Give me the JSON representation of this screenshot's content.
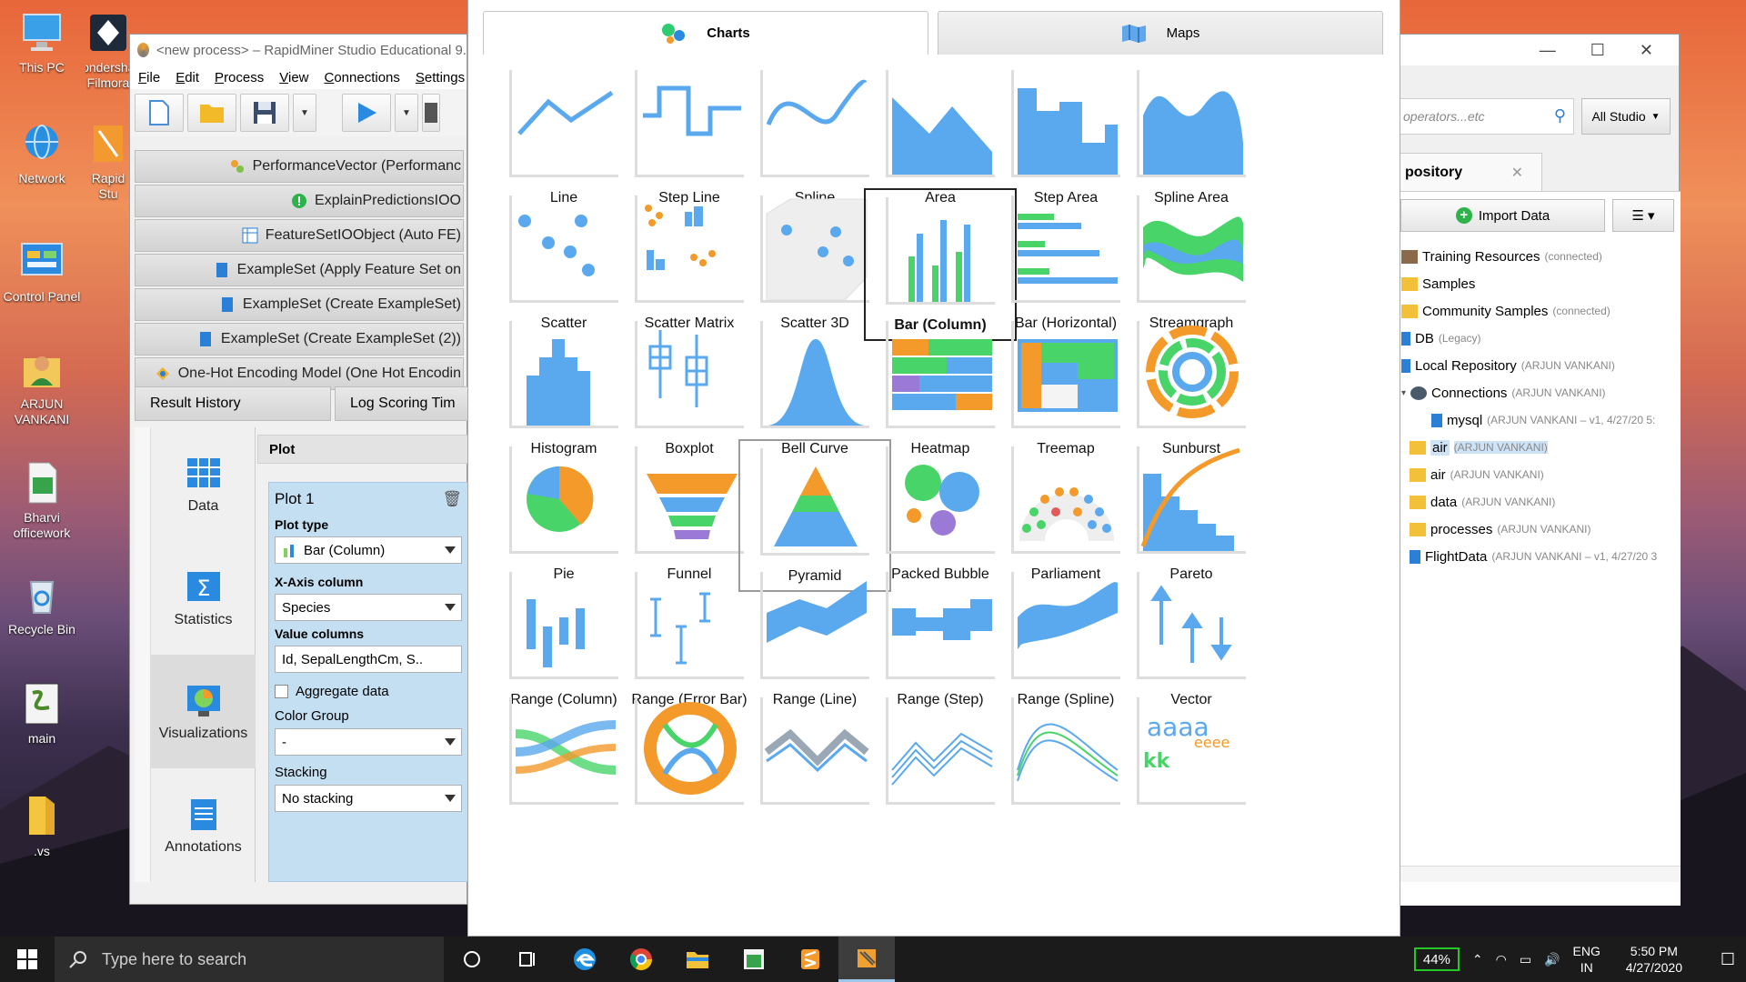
{
  "desktop": {
    "icons": [
      {
        "label": "This PC",
        "icon": "monitor-icon"
      },
      {
        "label": "Wondershare Filmora",
        "icon": "filmora-icon"
      },
      {
        "label": "Network",
        "icon": "network-globe-icon"
      },
      {
        "label": "Rapid Stu",
        "icon": "rapidminer-icon"
      },
      {
        "label": "Control Panel",
        "icon": "control-panel-icon"
      },
      {
        "label": "ARJUN VANKANI",
        "icon": "user-folder-icon"
      },
      {
        "label": "Bharvi officework",
        "icon": "excel-file-icon"
      },
      {
        "label": "Recycle Bin",
        "icon": "recycle-bin-icon"
      },
      {
        "label": "main",
        "icon": "script-icon"
      },
      {
        "label": ".vs",
        "icon": "folder-icon"
      }
    ]
  },
  "rapidminer": {
    "title": "<new process> – RapidMiner Studio Educational 9.",
    "menu": [
      "File",
      "Edit",
      "Process",
      "View",
      "Connections",
      "Settings"
    ],
    "results": [
      "PerformanceVector (Performanc",
      "ExplainPredictionsIOO",
      "FeatureSetIOObject (Auto FE)",
      "ExampleSet (Apply Feature Set on",
      "ExampleSet (Create ExampleSet)",
      "ExampleSet (Create ExampleSet (2))",
      "One-Hot Encoding Model (One Hot Encodin"
    ],
    "history_tabs": [
      "Result History",
      "Log Scoring Tim"
    ],
    "side_items": [
      "Data",
      "Statistics",
      "Visualizations",
      "Annotations"
    ],
    "plot": {
      "header": "Plot",
      "name": "Plot 1",
      "plot_type_label": "Plot type",
      "plot_type_value": "Bar (Column)",
      "x_axis_label": "X-Axis column",
      "x_axis_value": "Species",
      "value_columns_label": "Value columns",
      "value_columns_value": "Id, SepalLengthCm, S..",
      "aggregate_label": "Aggregate data",
      "color_group_label": "Color Group",
      "color_group_value": "-",
      "stacking_label": "Stacking",
      "stacking_value": "No stacking"
    }
  },
  "popup": {
    "tabs": [
      "Charts",
      "Maps"
    ],
    "selected": "Bar (Column)",
    "hovered": "Pyramid",
    "charts": [
      "Line",
      "Step Line",
      "Spline",
      "Area",
      "Step Area",
      "Spline Area",
      "Scatter",
      "Scatter Matrix",
      "Scatter 3D",
      "Bar (Column)",
      "Bar (Horizontal)",
      "Streamgraph",
      "Histogram",
      "Boxplot",
      "Bell Curve",
      "Heatmap",
      "Treemap",
      "Sunburst",
      "Pie",
      "Funnel",
      "Pyramid",
      "Packed Bubble",
      "Parliament",
      "Pareto",
      "Range (Column)",
      "Range (Error Bar)",
      "Range (Line)",
      "Range (Step)",
      "Range (Spline)",
      "Vector",
      "",
      "",
      "",
      "",
      "",
      ""
    ],
    "word_cloud_sample": {
      "a": "aaaa",
      "b": "kk",
      "c": "eeee"
    }
  },
  "repository": {
    "search_placeholder": "operators...etc",
    "scope": "All Studio",
    "tab_label": "pository",
    "import_label": "Import Data",
    "menu_label": "☰ ▾",
    "tree": [
      {
        "name": "Training Resources",
        "meta": "(connected)"
      },
      {
        "name": "Samples",
        "meta": ""
      },
      {
        "name": "Community Samples",
        "meta": "(connected)"
      },
      {
        "name": "DB",
        "meta": "(Legacy)"
      },
      {
        "name": "Local Repository",
        "meta": "(ARJUN VANKANI)"
      },
      {
        "name": "Connections",
        "meta": "(ARJUN VANKANI)"
      },
      {
        "name": "mysql",
        "meta": "(ARJUN VANKANI – v1, 4/27/20 5:"
      },
      {
        "name": "air",
        "meta": "(ARJUN VANKANI)"
      },
      {
        "name": "air",
        "meta": "(ARJUN VANKANI)"
      },
      {
        "name": "data",
        "meta": "(ARJUN VANKANI)"
      },
      {
        "name": "processes",
        "meta": "(ARJUN VANKANI)"
      },
      {
        "name": "FlightData",
        "meta": "(ARJUN VANKANI – v1, 4/27/20 3"
      }
    ]
  },
  "taskbar": {
    "search_placeholder": "Type here to search",
    "battery": "44%",
    "lang": "ENG",
    "region": "IN",
    "time": "5:50 PM",
    "date": "4/27/2020"
  }
}
